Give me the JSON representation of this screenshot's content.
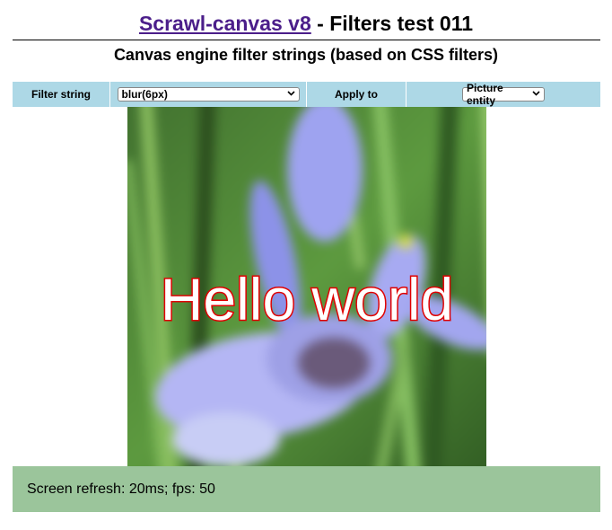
{
  "header": {
    "title_link": "Scrawl-canvas v8",
    "title_rest": " - Filters test 011",
    "subtitle": "Canvas engine filter strings (based on CSS filters)"
  },
  "controls": {
    "filter_label": "Filter string",
    "filter_value": "blur(6px)",
    "apply_label": "Apply to",
    "apply_value": "Picture entity"
  },
  "canvas": {
    "text": "Hello world",
    "text_fill": "#ffffff",
    "text_stroke": "#e00000"
  },
  "status": {
    "text": "Screen refresh: 20ms; fps: 50"
  },
  "colors": {
    "control_bg": "#add8e6",
    "status_bg": "#9bc59b",
    "link": "#4b1e8a"
  }
}
